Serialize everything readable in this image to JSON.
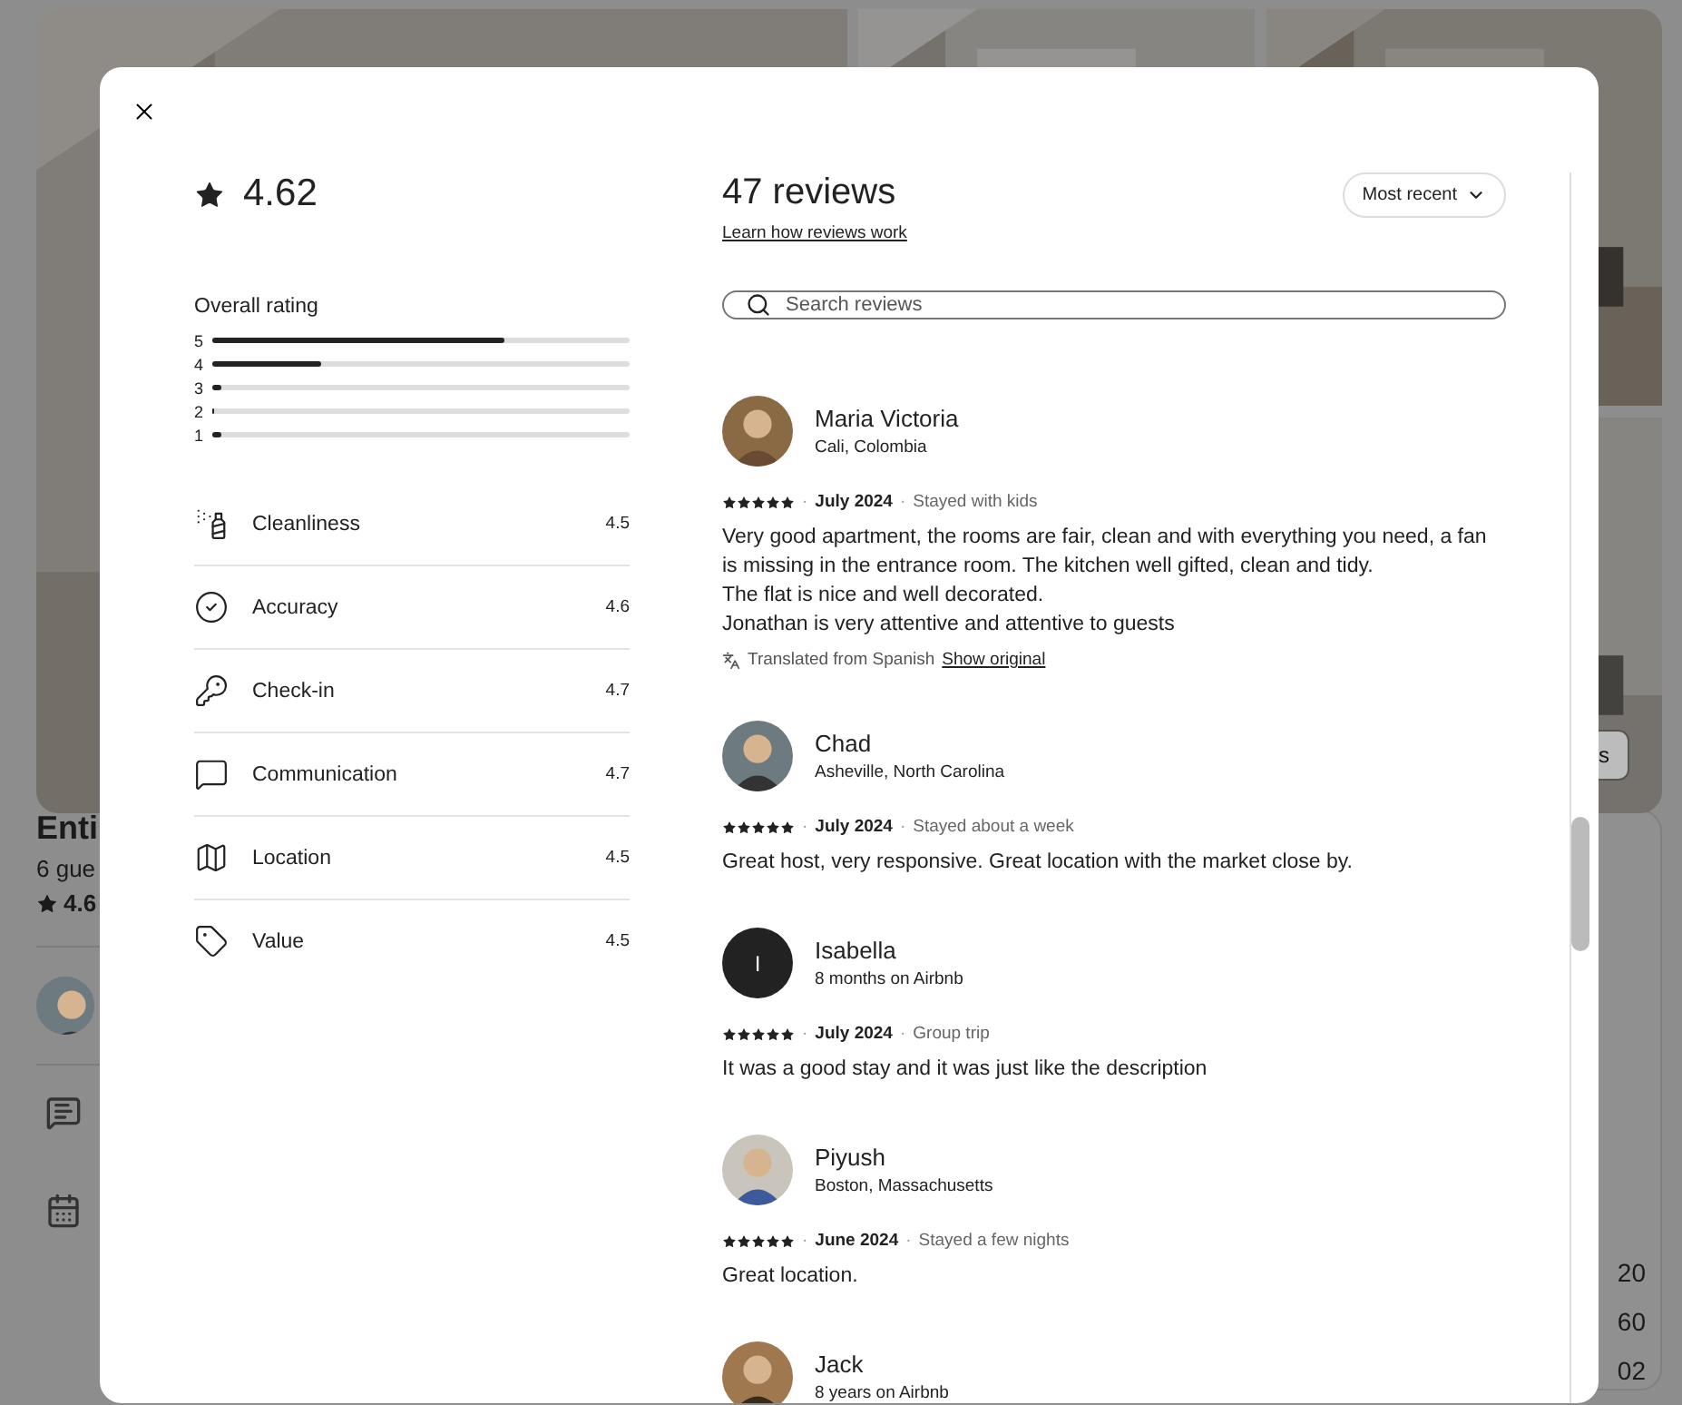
{
  "listing": {
    "title": "Enti",
    "guests": "6 gue",
    "rating": "4.6",
    "photo_button": "s",
    "prices": [
      "20",
      "60",
      "02"
    ]
  },
  "modal": {
    "rating": "4.62",
    "overall_rating": {
      "title": "Overall rating",
      "bars": [
        {
          "label": "5",
          "level": 0.7
        },
        {
          "label": "4",
          "level": 0.26
        },
        {
          "label": "3",
          "level": 0.02
        },
        {
          "label": "2",
          "level": 0
        },
        {
          "label": "1",
          "level": 0.02
        }
      ]
    },
    "categories": [
      {
        "kind": "cleanliness",
        "label": "Cleanliness",
        "score": "4.5"
      },
      {
        "kind": "accuracy",
        "label": "Accuracy",
        "score": "4.6"
      },
      {
        "kind": "checkin",
        "label": "Check-in",
        "score": "4.7"
      },
      {
        "kind": "communication",
        "label": "Communication",
        "score": "4.7"
      },
      {
        "kind": "location",
        "label": "Location",
        "score": "4.5"
      },
      {
        "kind": "value",
        "label": "Value",
        "score": "4.5"
      }
    ],
    "separator": "·",
    "reviews_title": "47 reviews",
    "learn_link": "Learn how reviews work",
    "sort": "Most recent",
    "search": {
      "placeholder": "Search reviews"
    },
    "reviews": [
      {
        "name": "Maria Victoria",
        "subtitle": "Cali, Colombia",
        "stars": 5,
        "date": "July 2024",
        "trip": "Stayed with kids",
        "text": [
          "Very good apartment, the rooms are fair, clean and with everything you need, a fan is missing in the entrance room. The kitchen well gifted, clean and tidy.",
          "The flat is nice and well decorated.",
          "Jonathan is very attentive and attentive to guests"
        ],
        "translation": {
          "note": "Translated from Spanish",
          "link": "Show original"
        }
      },
      {
        "name": "Chad",
        "subtitle": "Asheville, North Carolina",
        "stars": 5,
        "date": "July 2024",
        "trip": "Stayed about a week",
        "text": [
          "Great host, very responsive. Great location with the market close by."
        ]
      },
      {
        "name": "Isabella",
        "subtitle": "8 months on Airbnb",
        "avatar": {
          "kind": "initial",
          "letter": "I"
        },
        "stars": 5,
        "date": "July 2024",
        "trip": "Group trip",
        "text": [
          "It was a good stay and it was just like the description"
        ]
      },
      {
        "name": "Piyush",
        "subtitle": "Boston, Massachusetts",
        "stars": 5,
        "date": "June 2024",
        "trip": "Stayed a few nights",
        "text": [
          "Great location."
        ]
      },
      {
        "name": "Jack",
        "subtitle": "8 years on Airbnb"
      }
    ]
  }
}
